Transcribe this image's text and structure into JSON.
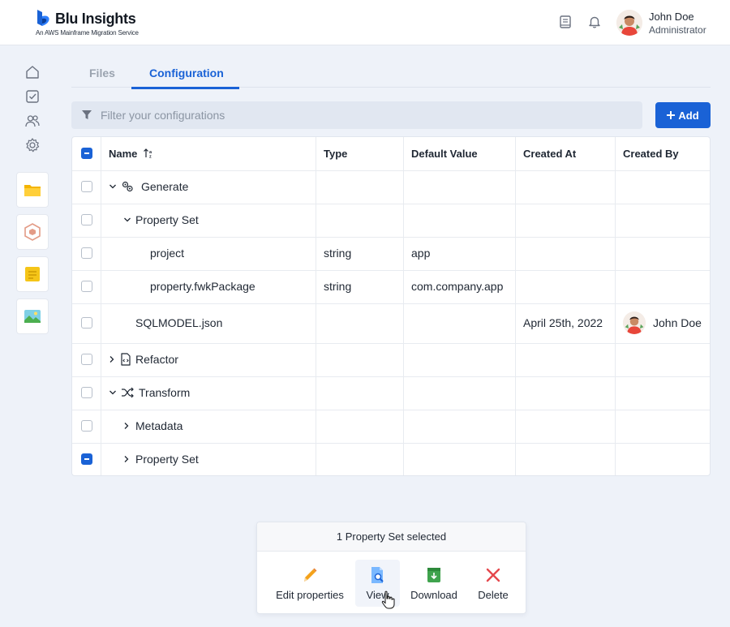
{
  "app": {
    "title": "Blu Insights",
    "subtitle": "An AWS Mainframe Migration Service",
    "brand_color": "#1a62d6"
  },
  "header": {
    "icons": [
      "book-icon",
      "bell-icon"
    ],
    "user": {
      "name": "John Doe",
      "role": "Administrator"
    }
  },
  "sidebar": {
    "nav_icons": [
      "home-icon",
      "checklist-icon",
      "users-icon",
      "settings-icon"
    ],
    "apps": [
      "folder-app",
      "cube-app",
      "notes-app",
      "image-app"
    ]
  },
  "tabs": [
    {
      "label": "Files",
      "active": false
    },
    {
      "label": "Configuration",
      "active": true
    }
  ],
  "filter": {
    "placeholder": "Filter your configurations",
    "value": ""
  },
  "add_button": {
    "label": "Add"
  },
  "table": {
    "columns": [
      "Name",
      "Type",
      "Default Value",
      "Created At",
      "Created By"
    ],
    "rows": [
      {
        "name": "Generate",
        "type": "",
        "default": "",
        "created_at": "",
        "created_by": "",
        "checked": false,
        "expanded": true,
        "icon": "gears-icon"
      },
      {
        "name": "Property Set",
        "type": "",
        "default": "",
        "created_at": "",
        "created_by": "",
        "checked": false,
        "expanded": true
      },
      {
        "name": "project",
        "type": "string",
        "default": "app",
        "created_at": "",
        "created_by": "",
        "checked": false
      },
      {
        "name": "property.fwkPackage",
        "type": "string",
        "default": "com.company.app",
        "created_at": "",
        "created_by": "",
        "checked": false
      },
      {
        "name": "SQLMODEL.json",
        "type": "",
        "default": "",
        "created_at": "April 25th, 2022",
        "created_by": "John Doe",
        "checked": false
      },
      {
        "name": "Refactor",
        "type": "",
        "default": "",
        "created_at": "",
        "created_by": "",
        "checked": false,
        "expanded": false,
        "icon": "file-code-icon"
      },
      {
        "name": "Transform",
        "type": "",
        "default": "",
        "created_at": "",
        "created_by": "",
        "checked": false,
        "expanded": true,
        "icon": "shuffle-icon"
      },
      {
        "name": "Metadata",
        "type": "",
        "default": "",
        "created_at": "",
        "created_by": "",
        "checked": false,
        "expanded": false
      },
      {
        "name": "Property Set",
        "type": "",
        "default": "",
        "created_at": "",
        "created_by": "",
        "checked": true,
        "expanded": false
      }
    ]
  },
  "selection": {
    "summary": "1 Property Set selected",
    "actions": [
      {
        "label": "Edit properties",
        "icon": "pencil-icon"
      },
      {
        "label": "View",
        "icon": "file-search-icon"
      },
      {
        "label": "Download",
        "icon": "download-icon"
      },
      {
        "label": "Delete",
        "icon": "close-icon"
      }
    ]
  }
}
